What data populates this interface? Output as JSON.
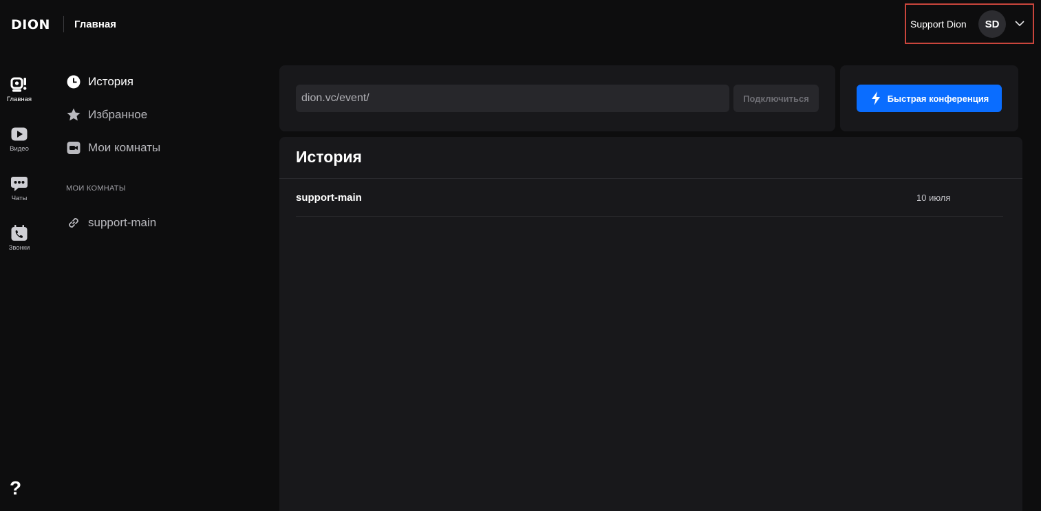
{
  "header": {
    "logo": "DION",
    "title": "Главная",
    "user_name": "Support Dion",
    "avatar_initials": "SD"
  },
  "rail": {
    "items": [
      {
        "label": "Главная",
        "icon": "home-icon",
        "active": true
      },
      {
        "label": "Видео",
        "icon": "video-play-icon",
        "active": false
      },
      {
        "label": "Чаты",
        "icon": "chat-icon",
        "active": false
      },
      {
        "label": "Звонки",
        "icon": "phone-calendar-icon",
        "active": false
      }
    ],
    "help": "?"
  },
  "nav": {
    "items": [
      {
        "label": "История",
        "icon": "clock-icon",
        "active": true
      },
      {
        "label": "Избранное",
        "icon": "star-icon",
        "active": false
      },
      {
        "label": "Мои комнаты",
        "icon": "camera-icon",
        "active": false
      }
    ],
    "section_title": "МОИ КОМНАТЫ",
    "rooms": [
      {
        "label": "support-main",
        "icon": "link-icon"
      }
    ]
  },
  "join": {
    "url_value": "dion.vc/event/",
    "connect_label": "Подключиться"
  },
  "quick": {
    "label": "Быстрая конференция",
    "icon": "lightning-icon"
  },
  "history": {
    "title": "История",
    "rows": [
      {
        "name": "support-main",
        "date": "10 июля"
      }
    ]
  },
  "colors": {
    "accent": "#0a6dff",
    "background": "#0d0d0e",
    "panel": "#18181b",
    "highlight_border": "#c9453c"
  }
}
